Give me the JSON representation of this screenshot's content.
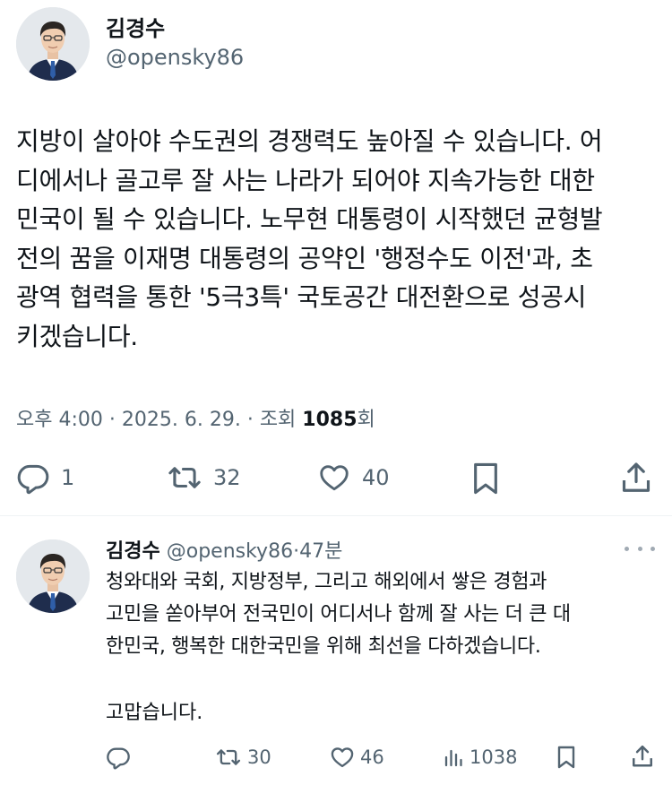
{
  "tweet": {
    "author_name": "김경수",
    "author_handle": "@opensky86",
    "text": "지방이 살아야 수도권의 경쟁력도 높아질 수 있습니다. 어\n디에서나 골고루 잘 사는 나라가 되어야 지속가능한 대한\n민국이 될 수 있습니다. 노무현 대통령이 시작했던 균형발\n전의 꿈을 이재명 대통령의 공약인 '행정수도 이전'과, 초\n광역 협력을 통한 '5극3특' 국토공간 대전환으로 성공시\n키겠습니다.",
    "meta": {
      "time": "오후 4:00",
      "sep1": " · ",
      "date": "2025. 6. 29.",
      "sep2": " · ",
      "views_prefix": "조회 ",
      "views_count": "1085",
      "views_suffix": "회"
    },
    "actions": {
      "replies": "1",
      "retweets": "32",
      "likes": "40"
    }
  },
  "reply": {
    "author_name": "김경수",
    "author_handle": "@opensky86",
    "dot": "·",
    "time": "47분",
    "text": "청와대와 국회, 지방정부, 그리고 해외에서 쌓은 경험과\n고민을 쏟아부어 전국민이 어디서나 함께 잘 사는 더 큰 대\n한민국, 행복한 대한국민을 위해 최선을 다하겠습니다.",
    "thanks": "고맙습니다.",
    "actions": {
      "retweets": "30",
      "likes": "46",
      "views": "1038"
    }
  },
  "icons": {
    "reply": "reply-icon",
    "retweet": "retweet-icon",
    "like": "heart-icon",
    "bookmark": "bookmark-icon",
    "share": "share-icon",
    "views": "views-icon",
    "more": "more-icon"
  },
  "colors": {
    "text": "#0f1419",
    "muted": "#536471",
    "divider": "#eff3f4"
  }
}
